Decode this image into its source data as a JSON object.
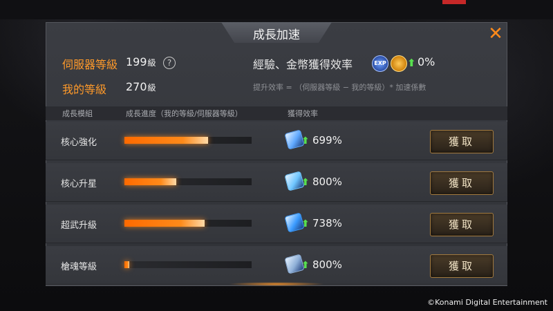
{
  "dialog": {
    "title": "成長加速",
    "close_glyph": "✕"
  },
  "info": {
    "server_level_label": "伺服器等級",
    "server_level_value": "199",
    "level_unit": "級",
    "help_glyph": "?",
    "my_level_label": "我的等級",
    "my_level_value": "270",
    "efficiency_title": "經驗、金幣獲得效率",
    "exp_badge": "EXP",
    "efficiency_pct": "0%",
    "formula": "提升效率 = （伺服器等級 − 我的等級）* 加速係數"
  },
  "columns": {
    "module": "成長模組",
    "progress": "成長進度（我的等級/伺服器等級）",
    "efficiency": "獲得效率"
  },
  "rows": [
    {
      "label": "核心強化",
      "progress": 0.66,
      "pct": "699%",
      "button": "獲取",
      "icon": "core-enhance-icon",
      "icon_color": "#5fa8ff"
    },
    {
      "label": "核心升星",
      "progress": 0.41,
      "pct": "800%",
      "button": "獲取",
      "icon": "core-star-icon",
      "icon_color": "#6fc6ff"
    },
    {
      "label": "超武升級",
      "progress": 0.63,
      "pct": "738%",
      "button": "獲取",
      "icon": "weapon-upgrade-icon",
      "icon_color": "#3a9bff"
    },
    {
      "label": "槍魂等級",
      "progress": 0.04,
      "pct": "800%",
      "button": "獲取",
      "icon": "gun-soul-icon",
      "icon_color": "#8fb0d8"
    }
  ],
  "arrow_glyph": "⬆",
  "copyright": "©Konami Digital Entertainment"
}
